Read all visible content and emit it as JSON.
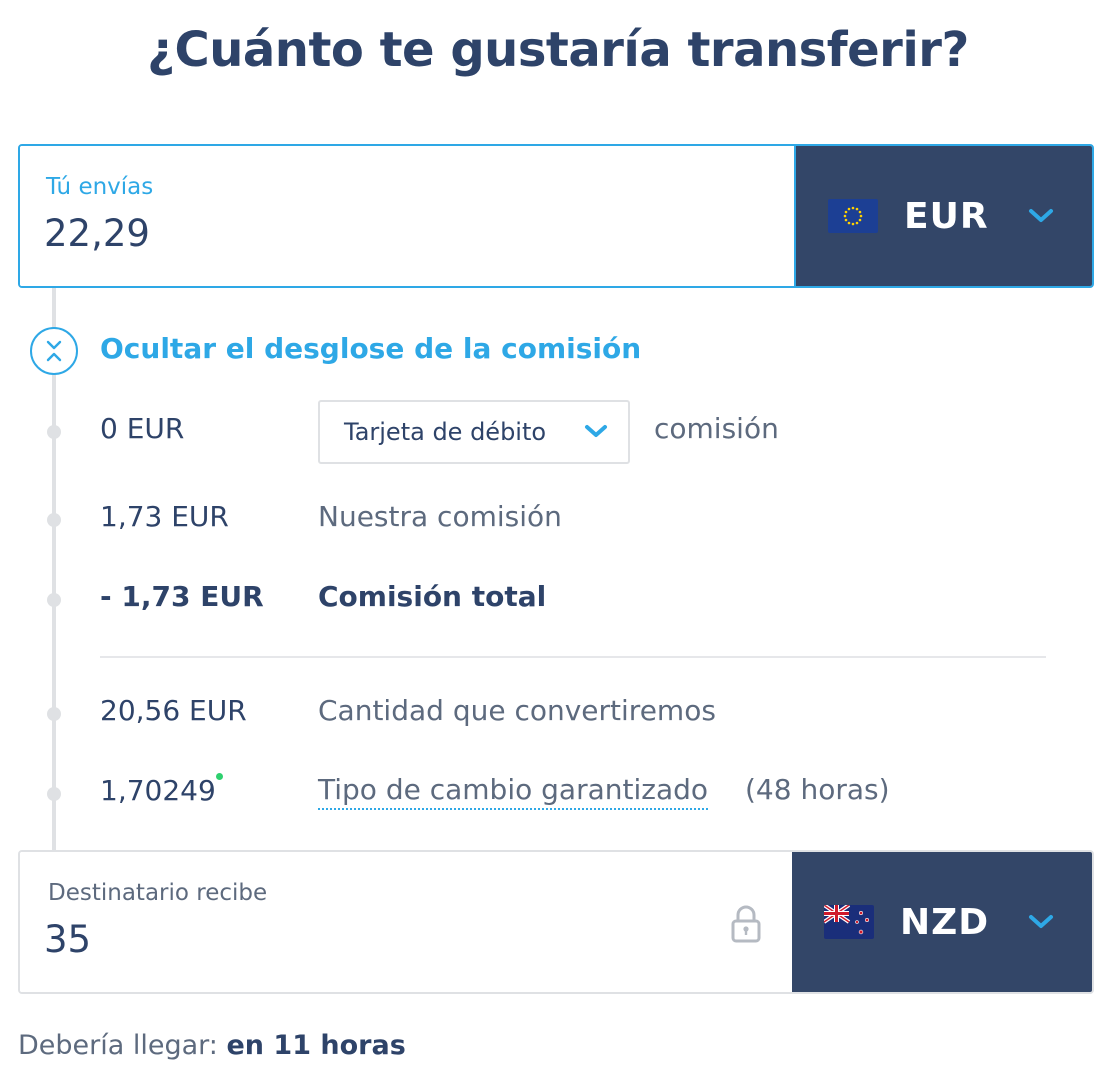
{
  "title": "¿Cuánto te gustaría transferir?",
  "send": {
    "label": "Tú envías",
    "amount": "22,29",
    "currency": "EUR",
    "flag": "eu-flag-icon"
  },
  "breakdown": {
    "toggle_label": "Ocultar el desglose de la comisión",
    "rows": {
      "payment_fee": {
        "amount": "0 EUR",
        "method": "Tarjeta de débito",
        "suffix": "comisión"
      },
      "our_fee": {
        "amount": "1,73 EUR",
        "label": "Nuestra comisión"
      },
      "total_fee": {
        "amount": "- 1,73 EUR",
        "label": "Comisión total"
      },
      "converted": {
        "amount": "20,56 EUR",
        "label": "Cantidad que convertiremos"
      },
      "rate": {
        "amount": "1,70249",
        "label": "Tipo de cambio garantizado",
        "suffix": "(48 horas)"
      }
    }
  },
  "receive": {
    "label": "Destinatario  recibe",
    "amount": "35",
    "currency": "NZD",
    "flag": "nz-flag-icon"
  },
  "arrival": {
    "label": "Debería llegar:",
    "value": "en 11 horas"
  },
  "colors": {
    "primary_text": "#2e4369",
    "accent": "#2ea8e6",
    "currency_bg": "#334668",
    "muted": "#5d6a7e",
    "rail": "#dfe1e4",
    "rate_dot": "#2ed06e"
  }
}
